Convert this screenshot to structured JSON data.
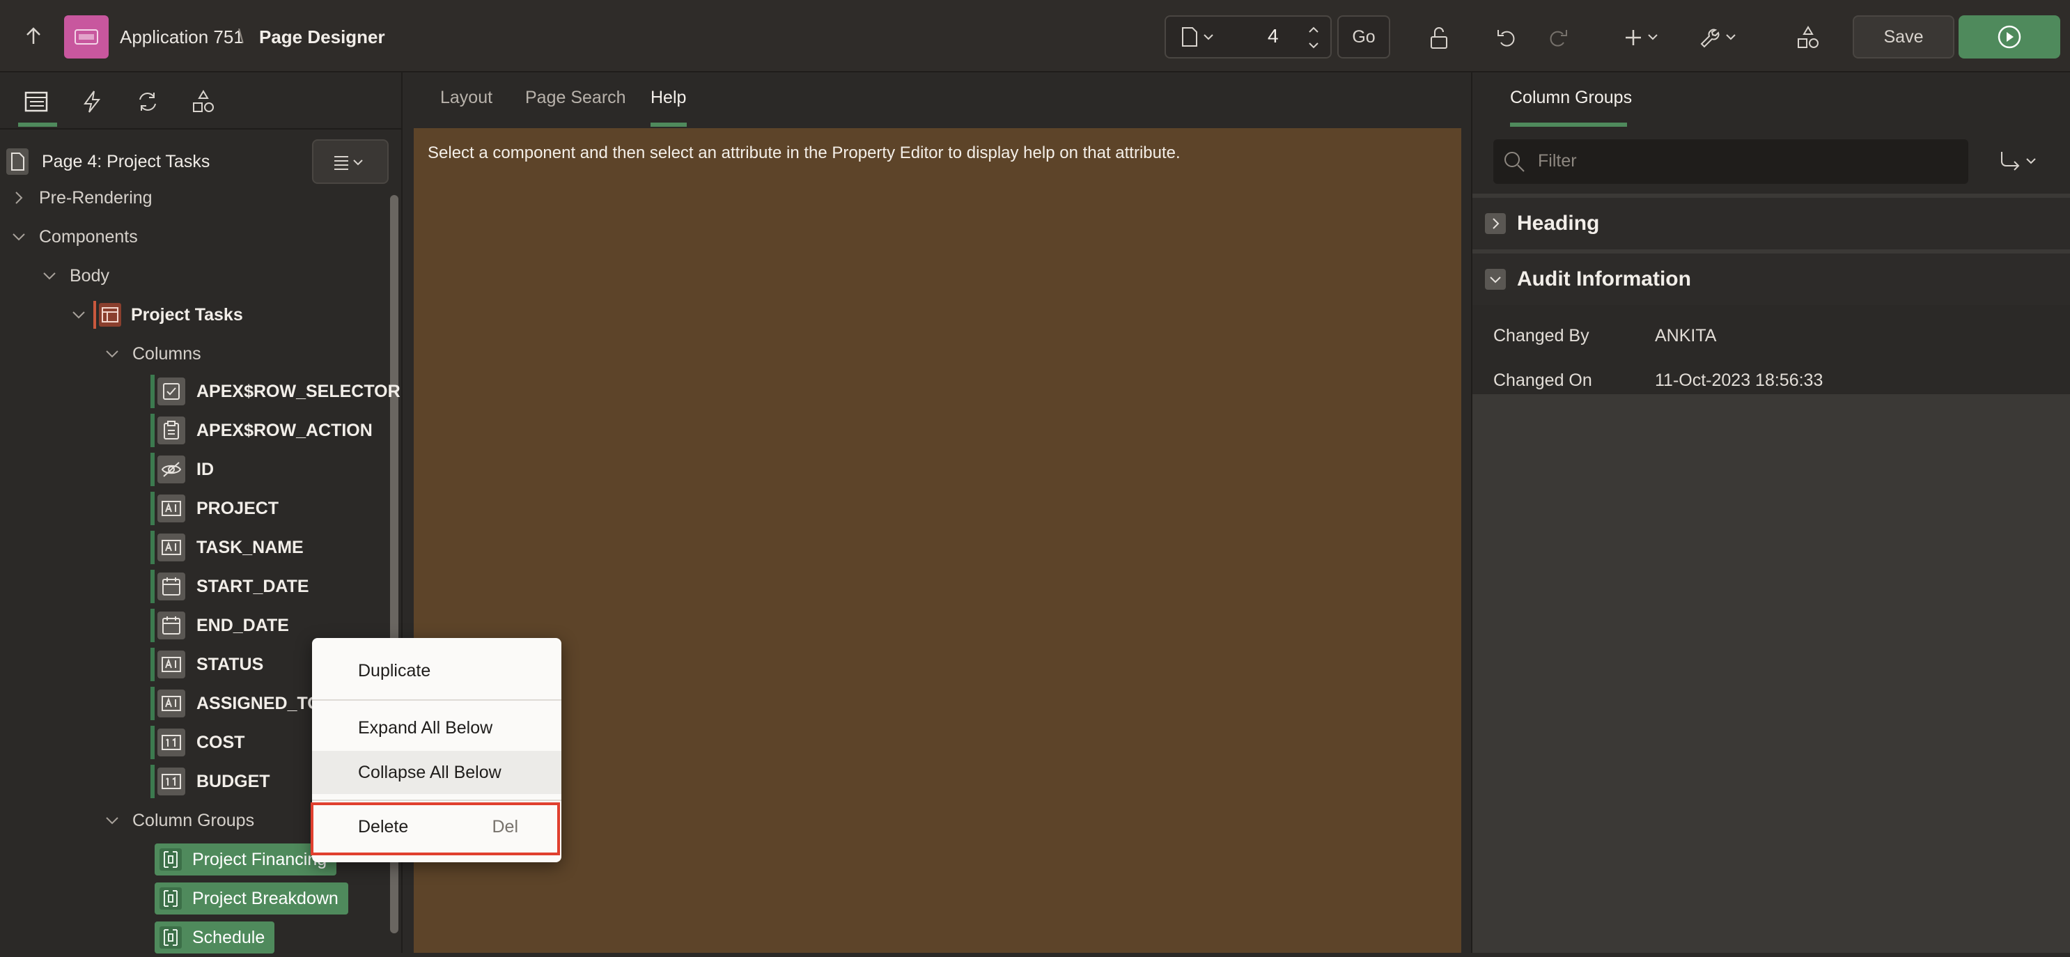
{
  "header": {
    "app_name": "Application 751",
    "separator": "\\",
    "page_name": "Page Designer",
    "page_number": "4",
    "go_label": "Go",
    "save_label": "Save"
  },
  "left_panel": {
    "page_title": "Page 4: Project Tasks",
    "tree": {
      "pre_rendering": "Pre-Rendering",
      "components": "Components",
      "body": "Body",
      "region": "Project Tasks",
      "columns": "Columns",
      "column_items": [
        "APEX$ROW_SELECTOR",
        "APEX$ROW_ACTION",
        "ID",
        "PROJECT",
        "TASK_NAME",
        "START_DATE",
        "END_DATE",
        "STATUS",
        "ASSIGNED_TO",
        "COST",
        "BUDGET"
      ],
      "column_groups": "Column Groups",
      "group_items": [
        "Project Financing",
        "Project Breakdown",
        "Schedule"
      ]
    }
  },
  "center": {
    "tabs": [
      "Layout",
      "Page Search",
      "Help"
    ],
    "active_tab": "Help",
    "help_text": "Select a component and then select an attribute in the Property Editor to display help on that attribute."
  },
  "right_panel": {
    "tab": "Column Groups",
    "filter_placeholder": "Filter",
    "sections": {
      "heading": "Heading",
      "audit": "Audit Information"
    },
    "properties": [
      {
        "label": "Changed By",
        "value": "ANKITA"
      },
      {
        "label": "Changed On",
        "value": "11-Oct-2023 18:56:33"
      }
    ]
  },
  "context_menu": {
    "duplicate": "Duplicate",
    "expand_all": "Expand All Below",
    "collapse_all": "Collapse All Below",
    "delete": "Delete",
    "delete_shortcut": "Del"
  },
  "colors": {
    "run_button": "#4f8a5c",
    "group_badge": "#4f8a5c",
    "help_background": "#5d4429",
    "highlight_border": "#e0402f",
    "app_icon": "#c8579e"
  }
}
